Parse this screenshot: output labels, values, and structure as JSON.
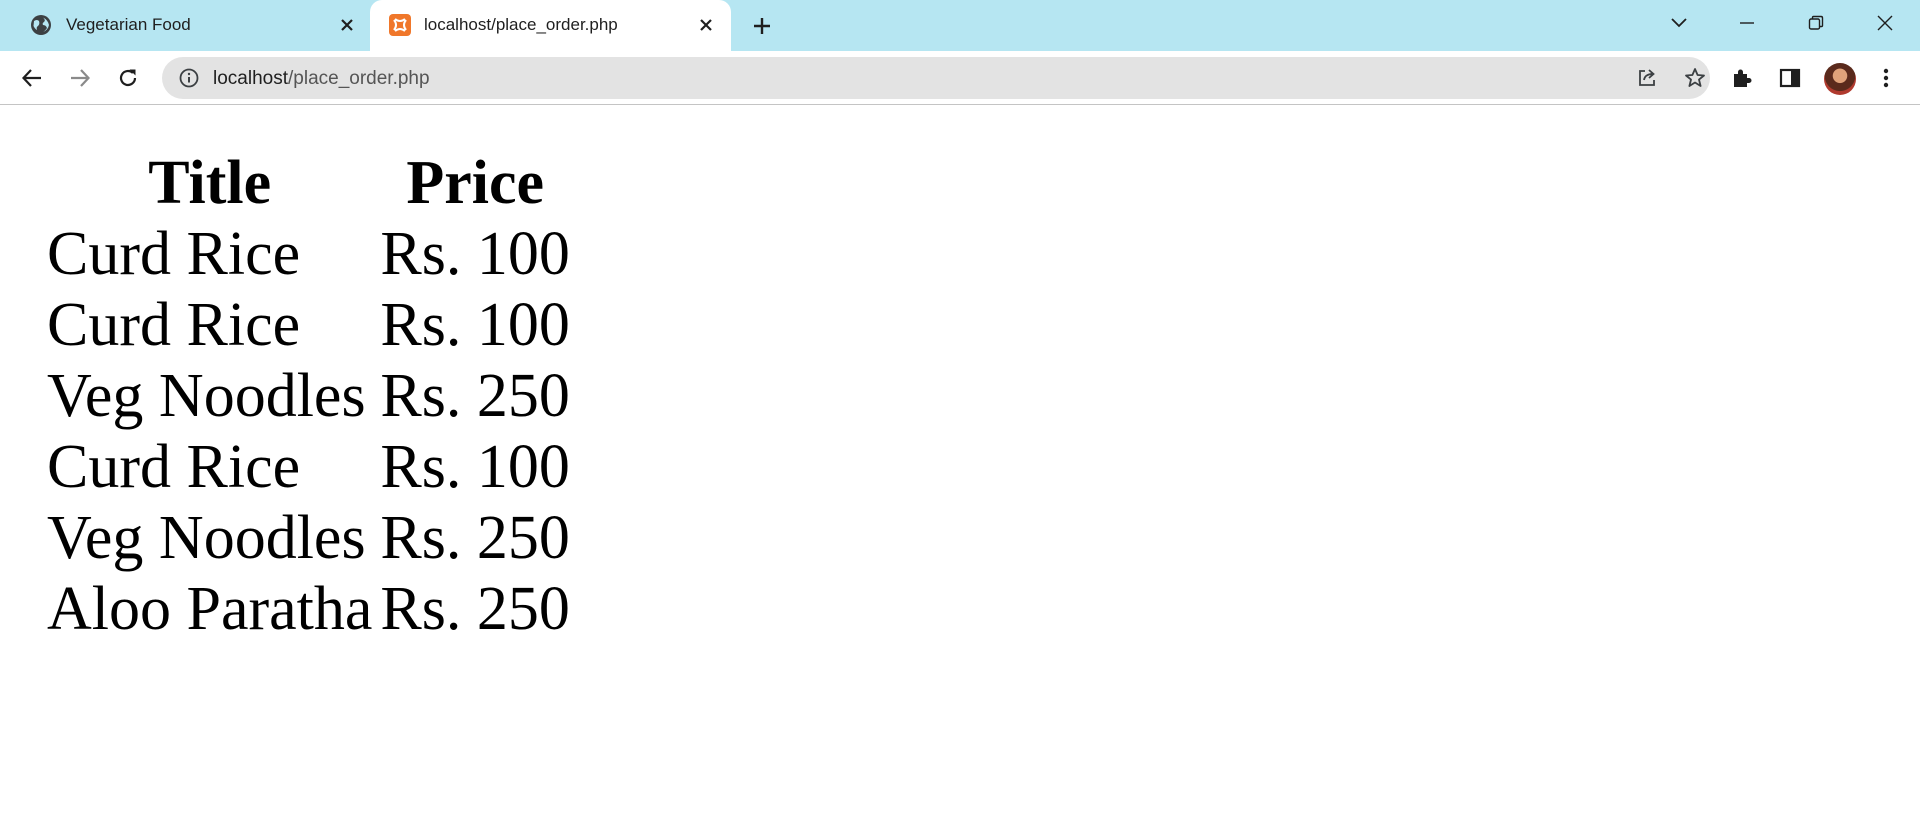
{
  "browser": {
    "tabs": [
      {
        "title": "Vegetarian Food",
        "active": false,
        "icon": "globe-icon"
      },
      {
        "title": "localhost/place_order.php",
        "active": true,
        "icon": "xampp-icon"
      }
    ],
    "address_bar": {
      "host": "localhost",
      "path": "/place_order.php"
    },
    "colors": {
      "tabstrip_bg": "#b6e6f2",
      "omnibox_bg": "#e3e3e3",
      "xampp_orange": "#f0772a"
    }
  },
  "page": {
    "table": {
      "headers": [
        "Title",
        "Price"
      ],
      "rows": [
        [
          "Curd Rice",
          "Rs. 100"
        ],
        [
          "Curd Rice",
          "Rs. 100"
        ],
        [
          "Veg Noodles",
          "Rs. 250"
        ],
        [
          "Curd Rice",
          "Rs. 100"
        ],
        [
          "Veg Noodles",
          "Rs. 250"
        ],
        [
          "Aloo Paratha",
          "Rs. 250"
        ]
      ]
    }
  }
}
